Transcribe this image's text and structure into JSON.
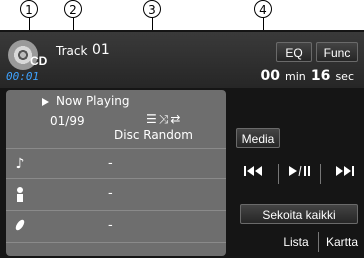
{
  "callouts": [
    "1",
    "2",
    "3",
    "4"
  ],
  "header": {
    "source_label": "CD",
    "elapsed_small": "00:01",
    "track_label": "Track",
    "track_number": "01",
    "eq_label": "EQ",
    "func_label": "Func",
    "elapsed_min": "00",
    "min_unit": "min",
    "elapsed_sec": "16",
    "sec_unit": "sec"
  },
  "now_playing": {
    "title": "Now Playing",
    "counter": "01/99",
    "mode_label": "Disc Random",
    "rows": [
      {
        "icon": "music-note-icon",
        "value": "-"
      },
      {
        "icon": "artist-icon",
        "value": "-"
      },
      {
        "icon": "album-icon",
        "value": "-"
      }
    ]
  },
  "controls": {
    "media_label": "Media",
    "shuffle_label": "Sekoita kaikki",
    "list_label": "Lista",
    "map_label": "Kartta"
  }
}
